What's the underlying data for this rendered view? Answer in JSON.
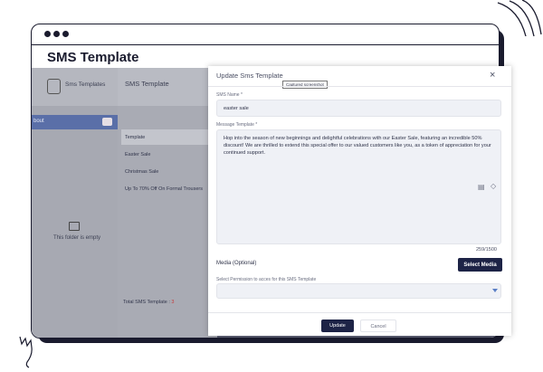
{
  "window": {
    "title": "SMS Template"
  },
  "sidebar": {
    "header_label": "Sms Templates",
    "active_item_label": "bout",
    "empty_message": "This folder is empty"
  },
  "template_list": {
    "title": "SMS Template",
    "items": [
      "Template",
      "Easter Sale",
      "Christmas Sale",
      "Up To 70% Off On Formal Trousers"
    ],
    "footer_label": "Total SMS Template : ",
    "footer_count": "3"
  },
  "modal": {
    "title": "Update Sms Template",
    "captured_label": "Captured screenshot",
    "close_glyph": "×",
    "name_label": "SMS Name *",
    "name_value": "easter sale",
    "message_label": "Message Template *",
    "message_value": "Hop into the season of new beginnings and delightful celebrations with our Easter Sale, featuring an incredible 50% discount! We are thrilled to extend this special offer to our valued customers like you, as a token of appreciation for your continued support.",
    "char_counter": "259/1500",
    "media_label": "Media (Optional)",
    "select_media_button": "Select Media",
    "permission_label": "Select Permission to acces for this SMS Template",
    "permission_value": "",
    "update_button": "Update",
    "cancel_button": "Cancel"
  },
  "colors": {
    "primary_dark": "#1d2346",
    "sidebar_active": "#5a6fa8",
    "overlay": "#5e6075",
    "count_red": "#c63a3a"
  },
  "icons": [
    "template-icon",
    "folder-icon",
    "close-icon",
    "attachment-icon",
    "tag-icon",
    "chevron-down-icon"
  ]
}
